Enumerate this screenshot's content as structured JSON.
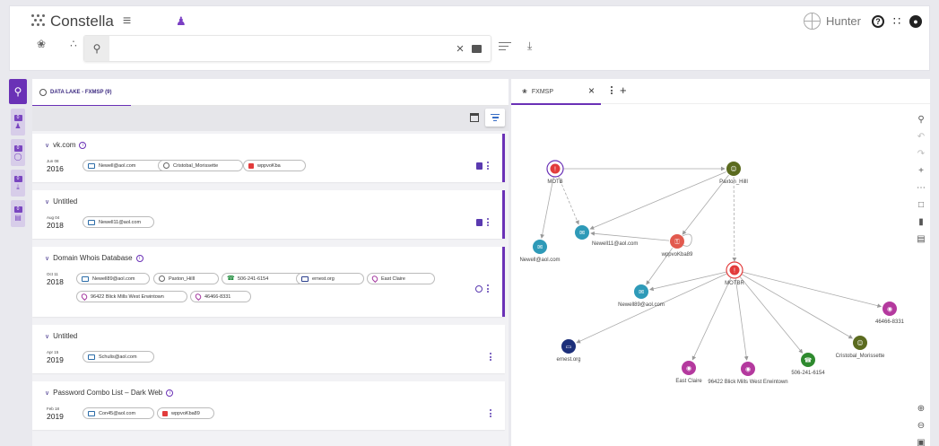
{
  "header": {
    "brand": "Constella",
    "user_name": "Hunter",
    "search": {
      "value": "",
      "placeholder": ""
    }
  },
  "icons": {
    "brand": "constella-dots-logo",
    "menu": "hamburger-icon",
    "user_switch": "user-switch-icon",
    "globe": "globe-outline-icon",
    "help": "help-circle-icon",
    "apps": "apps-grid-icon",
    "account": "account-circle-icon",
    "graph": "graph-icon",
    "tree": "tree-icon",
    "search": "search-icon",
    "clear": "close-icon",
    "camera": "image-search-icon",
    "filter": "filter-list-icon",
    "download": "download-icon"
  },
  "rail": {
    "items": [
      {
        "badge": "0",
        "icon": "person-search-icon"
      },
      {
        "badge": "0",
        "icon": "fingerprint-icon"
      },
      {
        "badge": "0",
        "icon": "download-icon"
      },
      {
        "badge": "0",
        "icon": "message-icon"
      }
    ]
  },
  "middle": {
    "tab_label": "DATA LAKE - FXMSP (9)"
  },
  "results": [
    {
      "title": "vk.com",
      "has_info": true,
      "date": "Jun 08",
      "year": "2016",
      "action": "document",
      "rows": [
        [
          {
            "type": "email",
            "value": "Newell@aol.com"
          },
          {
            "type": "user",
            "value": "Cristobal_Morissette"
          },
          {
            "type": "password",
            "value": "wppvoKba"
          }
        ]
      ]
    },
    {
      "title": "Untitled",
      "has_info": false,
      "date": "Aug 04",
      "year": "2018",
      "action": "document",
      "rows": [
        [
          {
            "type": "email",
            "value": "Newell11@aol.com"
          }
        ]
      ]
    },
    {
      "title": "Domain Whois Database",
      "has_info": true,
      "date": "Oct 11",
      "year": "2018",
      "action": "web",
      "rows": [
        [
          {
            "type": "email",
            "value": "Newell89@aol.com"
          },
          {
            "type": "user",
            "value": "Paxton_Hilll"
          },
          {
            "type": "phone",
            "value": "506-241-6154"
          },
          {
            "type": "domain",
            "value": "ernest.org"
          },
          {
            "type": "location",
            "value": "East Claire"
          }
        ],
        [
          {
            "type": "location",
            "value": "96422 Blick Mills West Erwintown"
          },
          {
            "type": "location",
            "value": "46466-8331"
          }
        ]
      ]
    },
    {
      "title": "Untitled",
      "has_info": false,
      "date": "Apr 15",
      "year": "2019",
      "action": "none",
      "rows": [
        [
          {
            "type": "email",
            "value": "Schulis@aol.com"
          }
        ]
      ]
    },
    {
      "title": "Password Combo List – Dark Web",
      "has_info": true,
      "date": "Feb 18",
      "year": "2019",
      "action": "none",
      "rows": [
        [
          {
            "type": "email",
            "value": "Con45@aol.com"
          },
          {
            "type": "password",
            "value": "wppvoKba89"
          }
        ]
      ]
    }
  ],
  "graph": {
    "tab_label": "FXMSP",
    "nodes": [
      {
        "id": "motb1",
        "label": "MOTB",
        "type": "alert"
      },
      {
        "id": "paxton",
        "label": "Paxton_Hilll",
        "type": "user"
      },
      {
        "id": "newell11",
        "label": "Newell11@aol.com",
        "type": "email"
      },
      {
        "id": "newell",
        "label": "Newell@aol.com",
        "type": "email"
      },
      {
        "id": "wppvo",
        "label": "wppvoKba89",
        "type": "password"
      },
      {
        "id": "motb2",
        "label": "MOTBR",
        "type": "alert"
      },
      {
        "id": "newell89",
        "label": "Newell89@aol.com",
        "type": "email"
      },
      {
        "id": "zip",
        "label": "46466-8331",
        "type": "location"
      },
      {
        "id": "cristobal",
        "label": "Cristobal_Morissette",
        "type": "user"
      },
      {
        "id": "ernest",
        "label": "ernest.org",
        "type": "domain"
      },
      {
        "id": "phone",
        "label": "506-241-6154",
        "type": "phone"
      },
      {
        "id": "eastclaire",
        "label": "East Claire",
        "type": "location"
      },
      {
        "id": "blick",
        "label": "96422 Blick Mills West Erwintown",
        "type": "location"
      }
    ],
    "edges": [
      [
        "motb1",
        "paxton",
        "solid"
      ],
      [
        "motb1",
        "newell",
        "solid"
      ],
      [
        "motb1",
        "newell11",
        "dashed"
      ],
      [
        "paxton",
        "newell11",
        "solid"
      ],
      [
        "paxton",
        "wppvo",
        "solid"
      ],
      [
        "paxton",
        "motb2",
        "dashed"
      ],
      [
        "wppvo",
        "newell11",
        "solid"
      ],
      [
        "wppvo",
        "newell89",
        "solid"
      ],
      [
        "motb2",
        "newell89",
        "solid"
      ],
      [
        "motb2",
        "ernest",
        "solid"
      ],
      [
        "motb2",
        "eastclaire",
        "solid"
      ],
      [
        "motb2",
        "blick",
        "solid"
      ],
      [
        "motb2",
        "phone",
        "solid"
      ],
      [
        "motb2",
        "cristobal",
        "solid"
      ],
      [
        "motb2",
        "zip",
        "solid"
      ]
    ],
    "colors": {
      "alert": "#e23b3b",
      "user": "#5b6b1f",
      "email": "#2e9ab8",
      "password": "#e25a4e",
      "location": "#b4399e",
      "domain": "#1c2f7a",
      "phone": "#2e8a2e"
    }
  },
  "colors": {
    "accent": "#6a31b6",
    "rail_item_bg": "#d7cde9"
  }
}
